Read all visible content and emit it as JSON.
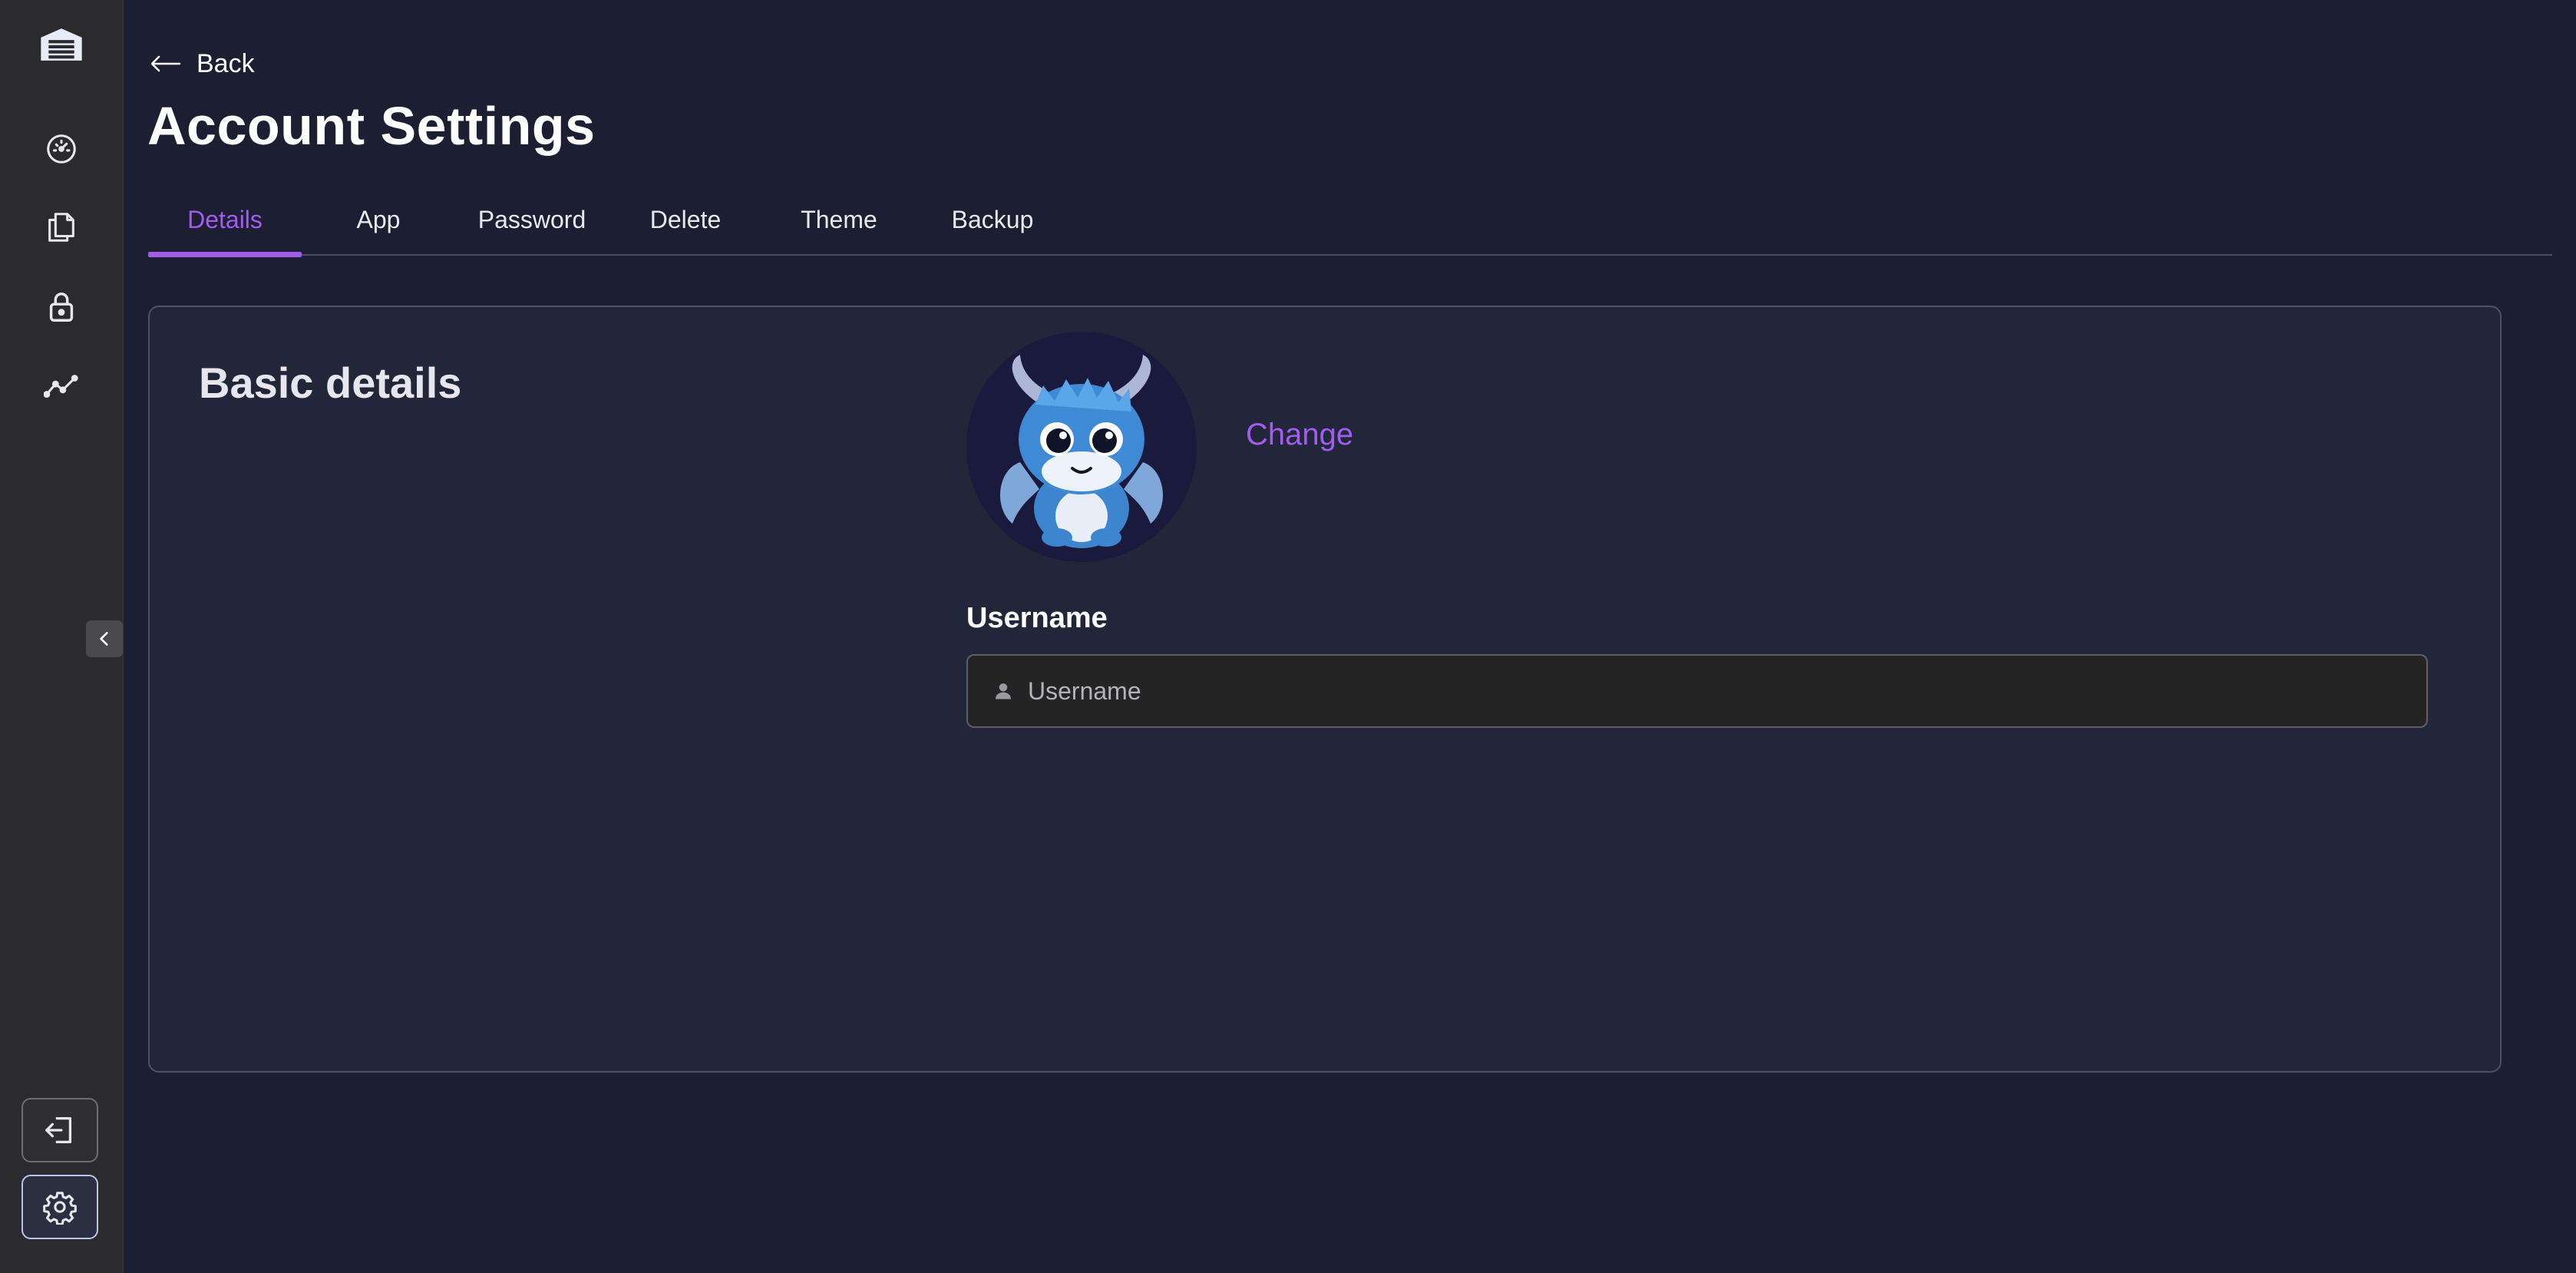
{
  "sidebar": {
    "logo_icon": "warehouse-icon",
    "items": [
      {
        "name": "dashboard",
        "icon": "speedometer-icon"
      },
      {
        "name": "files",
        "icon": "files-icon"
      },
      {
        "name": "security",
        "icon": "lock-icon"
      },
      {
        "name": "analytics",
        "icon": "trend-line-icon"
      }
    ],
    "collapse_icon": "chevron-left-icon",
    "logout_icon": "logout-icon",
    "settings_icon": "gear-icon"
  },
  "header": {
    "back_label": "Back",
    "title": "Account Settings"
  },
  "tabs": [
    {
      "label": "Details",
      "active": true
    },
    {
      "label": "App",
      "active": false
    },
    {
      "label": "Password",
      "active": false
    },
    {
      "label": "Delete",
      "active": false
    },
    {
      "label": "Theme",
      "active": false
    },
    {
      "label": "Backup",
      "active": false
    }
  ],
  "details": {
    "section_title": "Basic details",
    "change_label": "Change",
    "username_label": "Username",
    "username_placeholder": "Username",
    "username_value": ""
  },
  "colors": {
    "accent": "#a35cf0",
    "background": "#1c1f32",
    "sidebar": "#2b2b2d",
    "card": "#222639"
  }
}
